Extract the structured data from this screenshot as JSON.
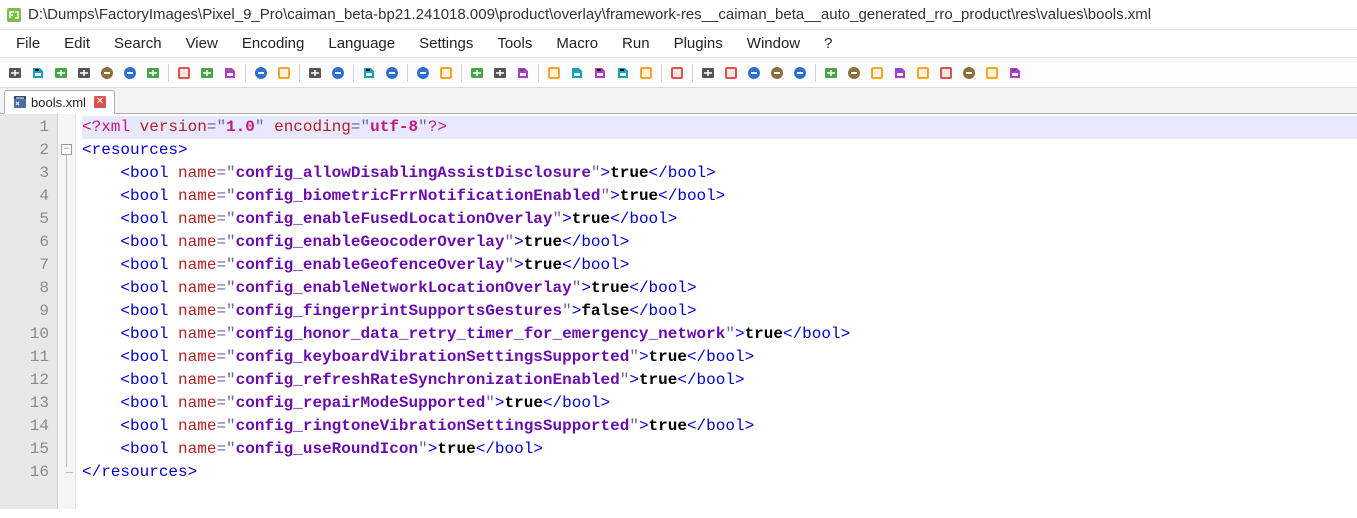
{
  "window": {
    "title": "D:\\Dumps\\FactoryImages\\Pixel_9_Pro\\caiman_beta-bp21.241018.009\\product\\overlay\\framework-res__caiman_beta__auto_generated_rro_product\\res\\values\\bools.xml"
  },
  "menus": [
    "File",
    "Edit",
    "Search",
    "View",
    "Encoding",
    "Language",
    "Settings",
    "Tools",
    "Macro",
    "Run",
    "Plugins",
    "Window",
    "?"
  ],
  "tab": {
    "filename": "bools.xml"
  },
  "xml": {
    "decl_version": "1.0",
    "decl_encoding": "utf-8",
    "root": "resources",
    "bools": [
      {
        "name": "config_allowDisablingAssistDisclosure",
        "value": "true"
      },
      {
        "name": "config_biometricFrrNotificationEnabled",
        "value": "true"
      },
      {
        "name": "config_enableFusedLocationOverlay",
        "value": "true"
      },
      {
        "name": "config_enableGeocoderOverlay",
        "value": "true"
      },
      {
        "name": "config_enableGeofenceOverlay",
        "value": "true"
      },
      {
        "name": "config_enableNetworkLocationOverlay",
        "value": "true"
      },
      {
        "name": "config_fingerprintSupportsGestures",
        "value": "false"
      },
      {
        "name": "config_honor_data_retry_timer_for_emergency_network",
        "value": "true"
      },
      {
        "name": "config_keyboardVibrationSettingsSupported",
        "value": "true"
      },
      {
        "name": "config_refreshRateSynchronizationEnabled",
        "value": "true"
      },
      {
        "name": "config_repairModeSupported",
        "value": "true"
      },
      {
        "name": "config_ringtoneVibrationSettingsSupported",
        "value": "true"
      },
      {
        "name": "config_useRoundIcon",
        "value": "true"
      }
    ]
  },
  "line_count": 16,
  "toolbar_icons": [
    "new-file-icon",
    "open-file-icon",
    "save-icon",
    "save-all-icon",
    "close-icon",
    "close-all-icon",
    "print-icon",
    "|",
    "cut-icon",
    "copy-icon",
    "paste-icon",
    "|",
    "undo-icon",
    "redo-icon",
    "|",
    "find-icon",
    "replace-icon",
    "|",
    "zoom-in-icon",
    "zoom-out-icon",
    "|",
    "sync-v-icon",
    "sync-h-icon",
    "|",
    "word-wrap-icon",
    "all-chars-icon",
    "indent-guide-icon",
    "|",
    "lang-udl-icon",
    "doc-map-icon",
    "doc-list-icon",
    "func-list-icon",
    "folder-workspace-icon",
    "|",
    "monitor-icon",
    "|",
    "record-icon",
    "stop-icon",
    "play-icon",
    "play-multi-icon",
    "save-macro-icon",
    "|",
    "outdent-icon",
    "spell-icon",
    "ruler-icon",
    "convert-icon",
    "bookmark-icon",
    "sort-asc-icon",
    "sort-desc-icon",
    "grid-icon",
    "end-icon"
  ]
}
